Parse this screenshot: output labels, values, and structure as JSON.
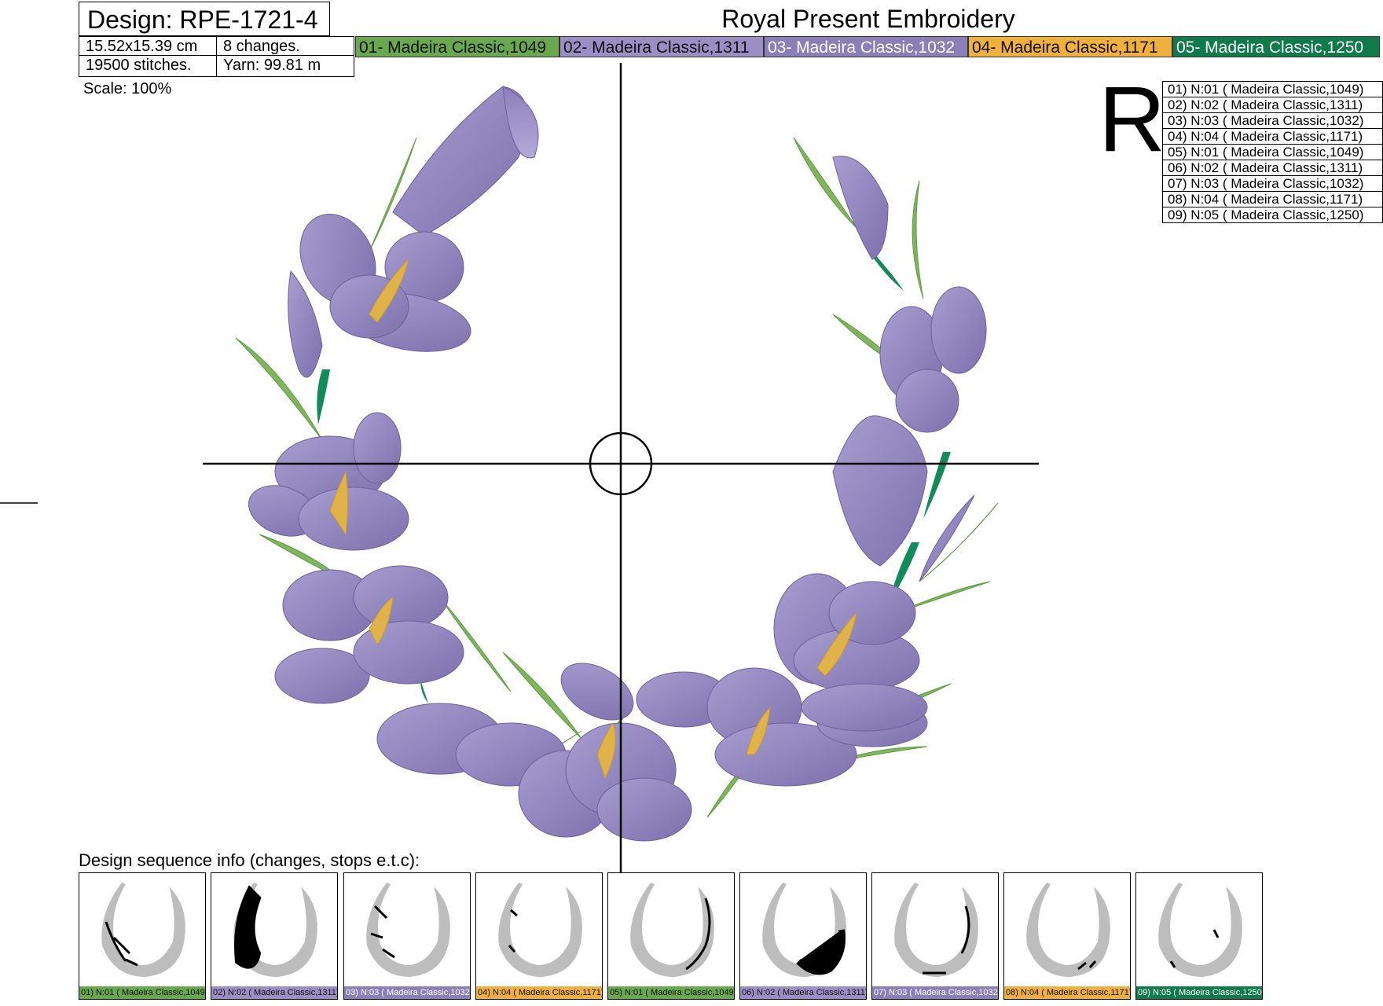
{
  "header": {
    "design_label": "Design: RPE-1721-4",
    "size": "15.52x15.39 cm",
    "changes": "8 changes.",
    "stitches": "19500 stitches.",
    "yarn": "Yarn: 99.81 m",
    "scale": "Scale: 100%",
    "brand": "Royal Present Embroidery",
    "badge_letter": "R"
  },
  "threads": [
    {
      "label": "01- Madeira Classic,1049",
      "bg": "#6aa84f",
      "fg": "#111111"
    },
    {
      "label": "02- Madeira Classic,1311",
      "bg": "#9b8ec4",
      "fg": "#111111"
    },
    {
      "label": "03- Madeira Classic,1032",
      "bg": "#8b7fb8",
      "fg": "#ffffff"
    },
    {
      "label": "04- Madeira Classic,1171",
      "bg": "#f0b040",
      "fg": "#111111"
    },
    {
      "label": "05- Madeira Classic,1250",
      "bg": "#0f7a4a",
      "fg": "#ffffff"
    }
  ],
  "sequence": [
    "01) N:01 ( Madeira Classic,1049)",
    "02) N:02 ( Madeira Classic,1311)",
    "03) N:03 ( Madeira Classic,1032)",
    "04) N:04 ( Madeira Classic,1171)",
    "05) N:01 ( Madeira Classic,1049)",
    "06) N:02 ( Madeira Classic,1311)",
    "07) N:03 ( Madeira Classic,1032)",
    "08) N:04 ( Madeira Classic,1171)",
    "09) N:05 ( Madeira Classic,1250)"
  ],
  "sequence_heading": "Design sequence info (changes, stops e.t.c):",
  "thumbnails": [
    {
      "label": "01) N:01 ( Madeira Classic,1049)",
      "bg": "#6aa84f",
      "fg": "#111111"
    },
    {
      "label": "02) N:02 ( Madeira Classic,1311)",
      "bg": "#9b8ec4",
      "fg": "#111111"
    },
    {
      "label": "03) N:03 ( Madeira Classic,1032)",
      "bg": "#8b7fb8",
      "fg": "#ffffff"
    },
    {
      "label": "04) N:04 ( Madeira Classic,1171)",
      "bg": "#f0b040",
      "fg": "#111111"
    },
    {
      "label": "05) N:01 ( Madeira Classic,1049)",
      "bg": "#6aa84f",
      "fg": "#111111"
    },
    {
      "label": "06) N:02 ( Madeira Classic,1311)",
      "bg": "#9b8ec4",
      "fg": "#111111"
    },
    {
      "label": "07) N:03 ( Madeira Classic,1032)",
      "bg": "#8b7fb8",
      "fg": "#ffffff"
    },
    {
      "label": "08) N:04 ( Madeira Classic,1171)",
      "bg": "#f0b040",
      "fg": "#111111"
    },
    {
      "label": "09) N:05 ( Madeira Classic,1250)",
      "bg": "#0f7a4a",
      "fg": "#ffffff"
    }
  ]
}
